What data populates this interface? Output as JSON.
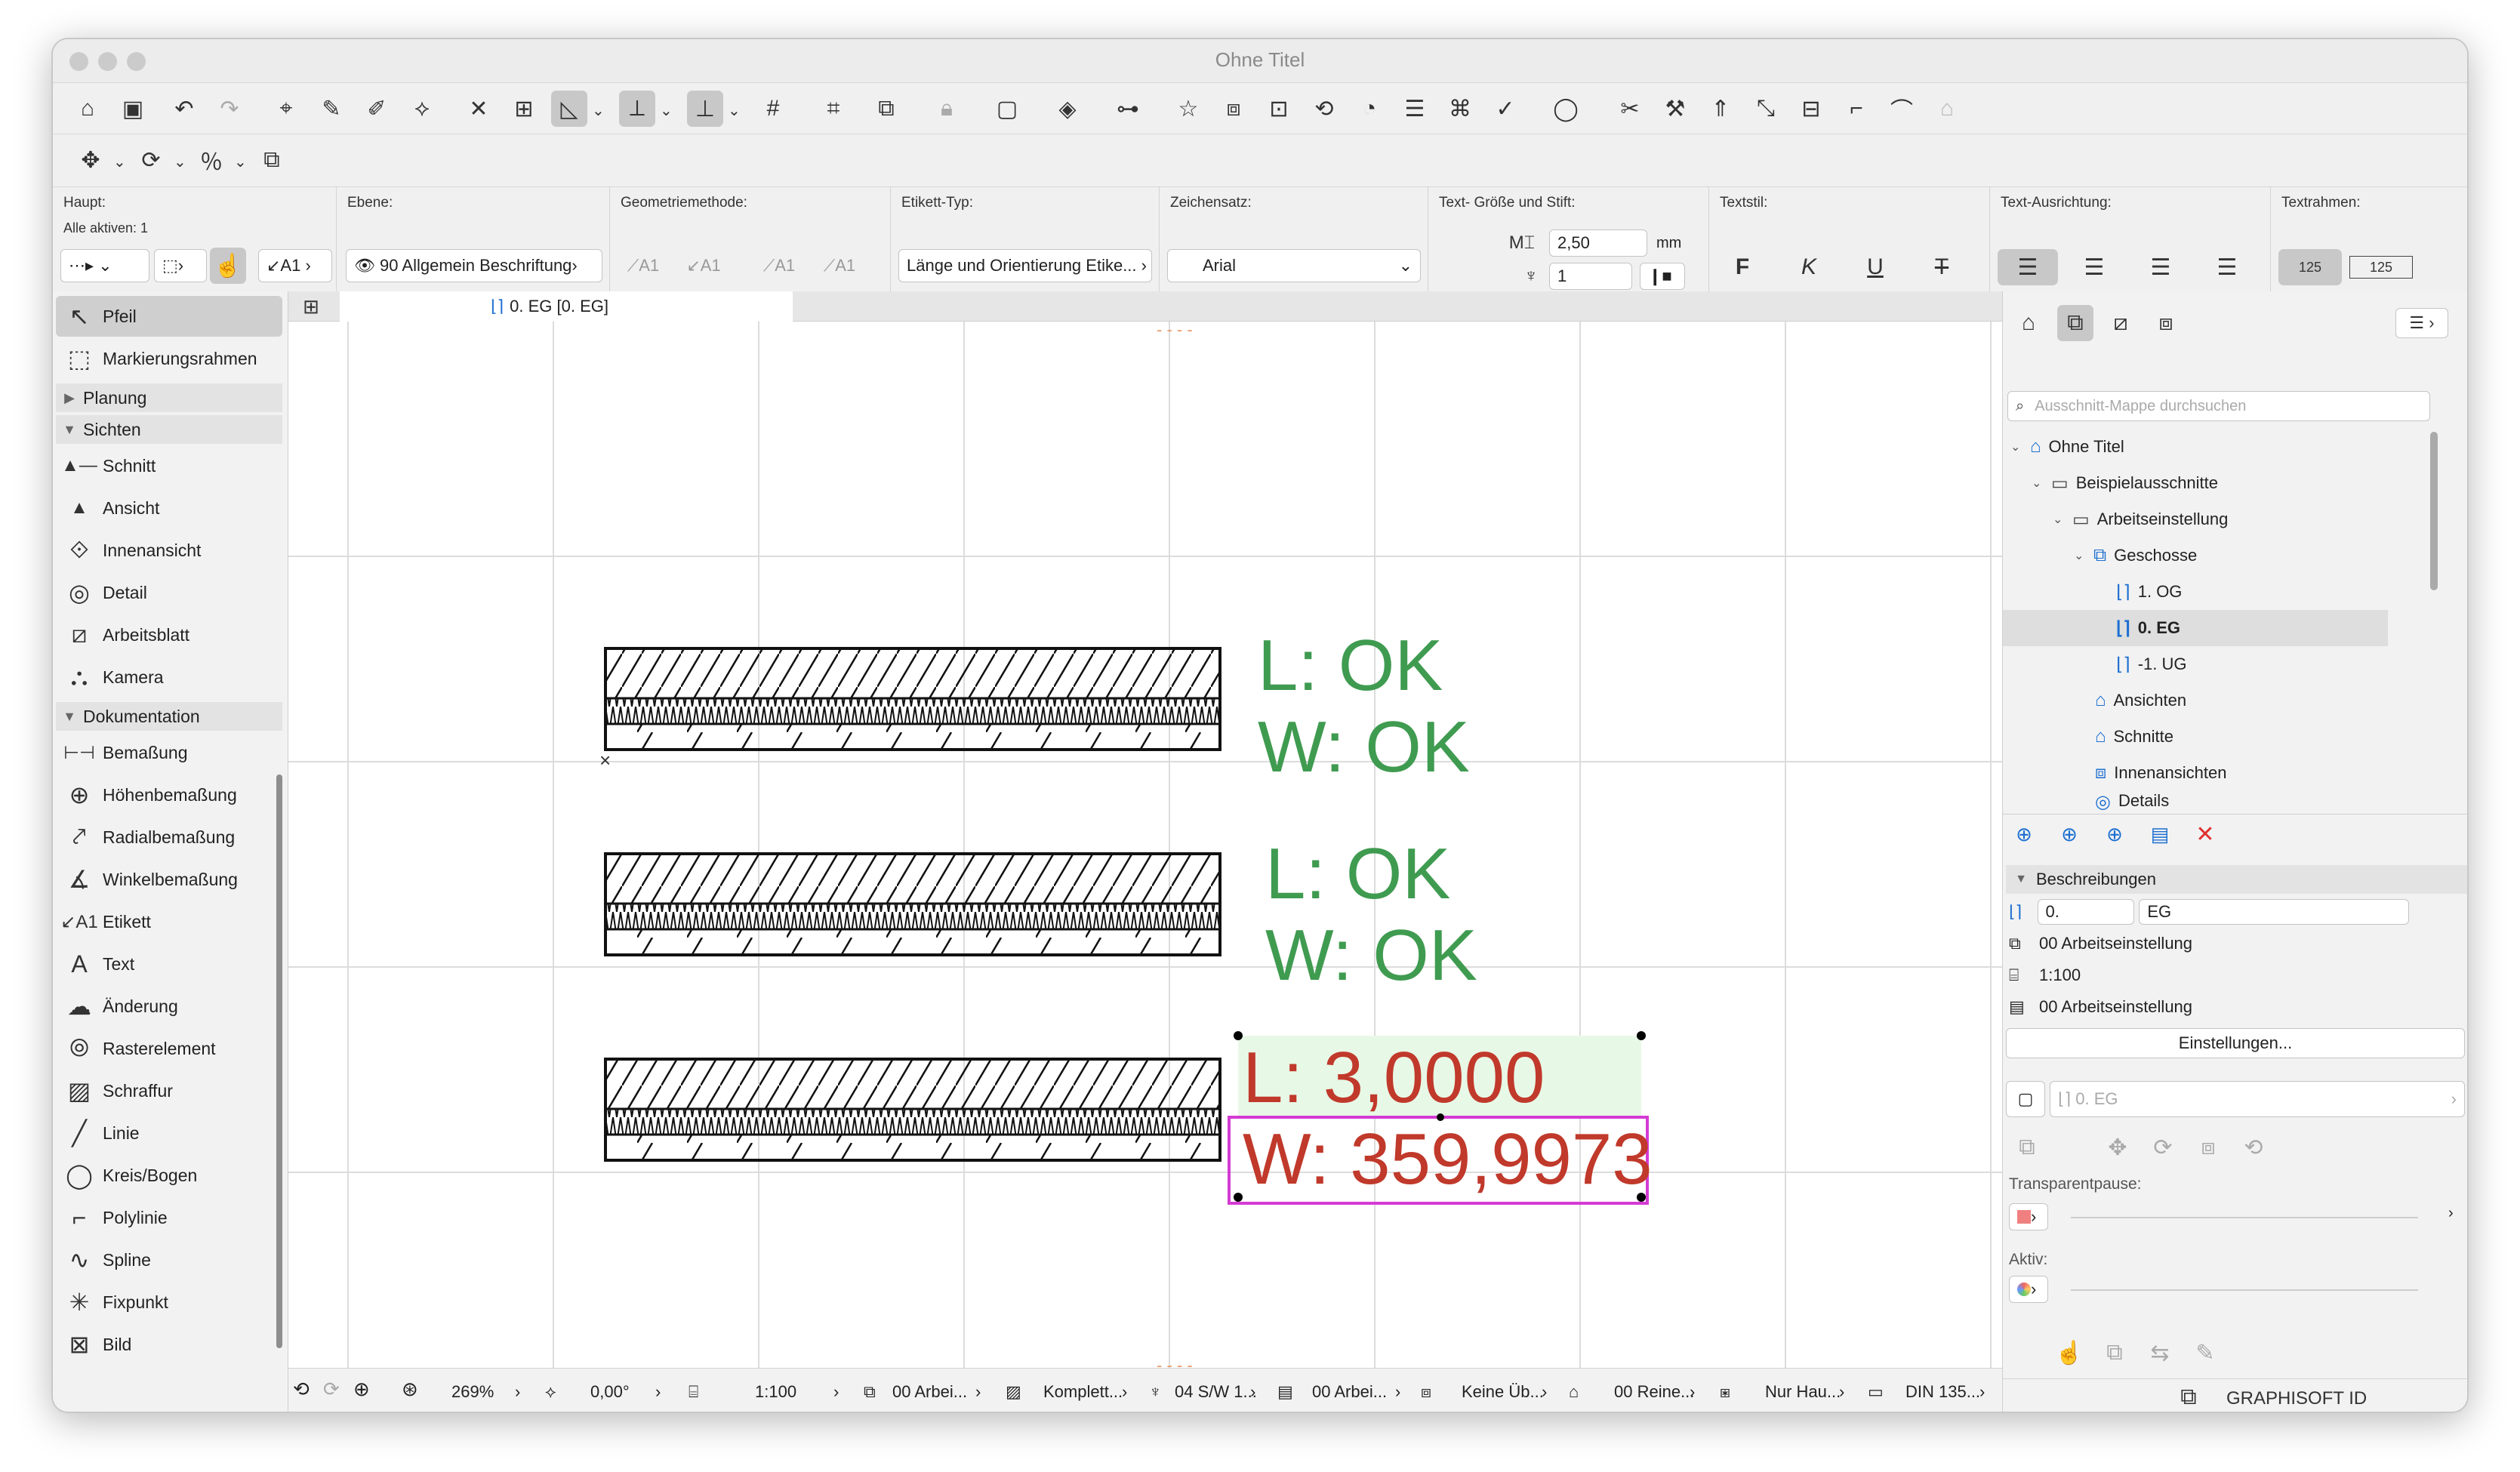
{
  "window": {
    "title": "Ohne Titel"
  },
  "infobox": {
    "haupt": {
      "label": "Haupt:",
      "active": "Alle aktiven: 1"
    },
    "ebene": {
      "label": "Ebene:",
      "value": "90 Allgemein Beschriftung"
    },
    "geometrie": {
      "label": "Geometriemethode:"
    },
    "etikett": {
      "label": "Etikett-Typ:",
      "value": "Länge und Orientierung Etike..."
    },
    "zeichensatz": {
      "label": "Zeichensatz:",
      "value": "Arial"
    },
    "textgroesse": {
      "label": "Text- Größe und Stift:",
      "size": "2,50",
      "unit": "mm",
      "pen": "1"
    },
    "textstil": {
      "label": "Textstil:",
      "bold": "F",
      "italic": "K",
      "underline": "U",
      "strike": "T"
    },
    "ausrichtung": {
      "label": "Text-Ausrichtung:"
    },
    "textrahmen": {
      "label": "Textrahmen:",
      "opt1": "125",
      "opt2": "125"
    }
  },
  "toolbox": {
    "items": [
      {
        "label": "Pfeil",
        "icon": "arrow-icon"
      },
      {
        "label": "Markierungsrahmen",
        "icon": "marquee-icon"
      }
    ],
    "groups": [
      "Planung",
      "Sichten",
      "Dokumentation"
    ],
    "sichten": [
      {
        "label": "Schnitt",
        "icon": "section-icon"
      },
      {
        "label": "Ansicht",
        "icon": "elevation-icon"
      },
      {
        "label": "Innenansicht",
        "icon": "interior-elevation-icon"
      },
      {
        "label": "Detail",
        "icon": "detail-icon"
      },
      {
        "label": "Arbeitsblatt",
        "icon": "worksheet-icon"
      },
      {
        "label": "Kamera",
        "icon": "camera-icon"
      }
    ],
    "dokumentation": [
      {
        "label": "Bemaßung",
        "icon": "dimension-icon"
      },
      {
        "label": "Höhenbemaßung",
        "icon": "level-dimension-icon"
      },
      {
        "label": "Radialbemaßung",
        "icon": "radial-dimension-icon"
      },
      {
        "label": "Winkelbemaßung",
        "icon": "angle-dimension-icon"
      },
      {
        "label": "Etikett",
        "icon": "label-icon"
      },
      {
        "label": "Text",
        "icon": "text-icon"
      },
      {
        "label": "Änderung",
        "icon": "change-icon"
      },
      {
        "label": "Rasterelement",
        "icon": "grid-element-icon"
      },
      {
        "label": "Schraffur",
        "icon": "fill-icon"
      },
      {
        "label": "Linie",
        "icon": "line-icon"
      },
      {
        "label": "Kreis/Bogen",
        "icon": "arc-icon"
      },
      {
        "label": "Polylinie",
        "icon": "polyline-icon"
      },
      {
        "label": "Spline",
        "icon": "spline-icon"
      },
      {
        "label": "Fixpunkt",
        "icon": "hotspot-icon"
      },
      {
        "label": "Bild",
        "icon": "image-icon"
      }
    ]
  },
  "tab": {
    "label": "0. EG [0. EG]"
  },
  "canvas": {
    "labels": [
      {
        "l": "L: OK",
        "w": "W: OK",
        "color": "#3f9b50"
      },
      {
        "l": "L: OK",
        "w": "W: OK",
        "color": "#3f9b50"
      },
      {
        "l": "L: 3,0000",
        "w": "W: 359,9973",
        "color": "#c0392b"
      }
    ]
  },
  "status": {
    "zoom": "269%",
    "angle": "0,00°",
    "scale": "1:100",
    "ebene": "00 Arbei...",
    "komplett": "Komplett...",
    "pen": "04 S/W 1...",
    "ebene2": "00 Arbei...",
    "ueber": "Keine Üb...",
    "reine": "00 Reine...",
    "haupt": "Nur Hau...",
    "din": "DIN 135..."
  },
  "navigator": {
    "search_placeholder": "Ausschnitt-Mappe durchsuchen",
    "tree": [
      {
        "label": "Ohne Titel",
        "bold": false
      },
      {
        "label": "Beispielausschnitte",
        "bold": false
      },
      {
        "label": "Arbeitseinstellung",
        "bold": false
      },
      {
        "label": "Geschosse",
        "bold": false
      },
      {
        "label": "1. OG",
        "bold": false
      },
      {
        "label": "0. EG",
        "bold": true
      },
      {
        "label": "-1. UG",
        "bold": false
      },
      {
        "label": "Ansichten",
        "bold": false
      },
      {
        "label": "Schnitte",
        "bold": false
      },
      {
        "label": "Innenansichten",
        "bold": false
      },
      {
        "label": "Details",
        "bold": false
      }
    ],
    "props": {
      "header": "Beschreibungen",
      "id": "0.",
      "name": "EG",
      "setting1": "00 Arbeitseinstellung",
      "scale": "1:100",
      "setting2": "00 Arbeitseinstellung",
      "button": "Einstellungen...",
      "source": "0. EG",
      "transparent": "Transparentpause:",
      "aktiv": "Aktiv:"
    },
    "footer": "GRAPHISOFT ID"
  }
}
